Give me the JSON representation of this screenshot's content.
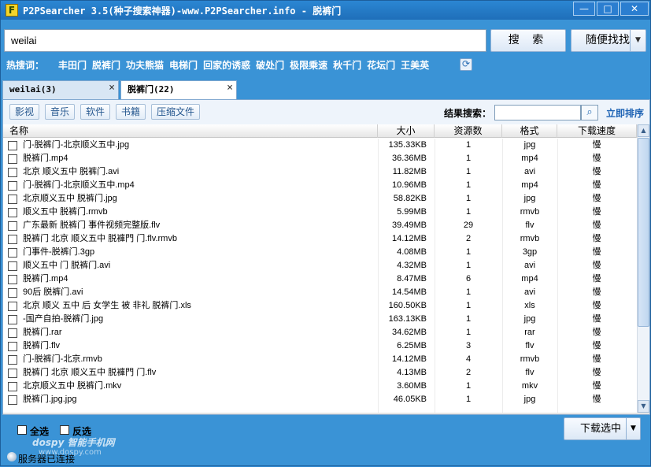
{
  "window": {
    "icon_letter": "F",
    "title": "P2PSearcher 3.5(种子搜索神器)-www.P2PSearcher.info - 脱裤门",
    "min_glyph": "—",
    "max_glyph": "□",
    "close_glyph": "✕"
  },
  "search": {
    "query": "weilai",
    "search_button": "搜 索",
    "random_button": "随便找找"
  },
  "hot": {
    "label": "热搜词：",
    "items": [
      "丰田门",
      "脱裤门",
      "功夫熊猫",
      "电梯门",
      "回家的诱惑",
      "破处门",
      "极限乘速",
      "秋千门",
      "花坛门",
      "王美英"
    ]
  },
  "tabs": [
    {
      "label": "weilai(3)"
    },
    {
      "label": "脱裤门(22)"
    }
  ],
  "filters": [
    "影视",
    "音乐",
    "软件",
    "书籍",
    "压缩文件"
  ],
  "result_search": {
    "label": "结果搜索：",
    "sort_link": "立即排序"
  },
  "table": {
    "headers": {
      "name": "名称",
      "size": "大小",
      "sources": "资源数",
      "format": "格式",
      "speed": "下载速度"
    },
    "rows": [
      {
        "name": "门-脱裤门-北京顺义五中.jpg",
        "size": "135.33KB",
        "sources": "1",
        "format": "jpg",
        "speed": "慢"
      },
      {
        "name": "脱裤门.mp4",
        "size": "36.36MB",
        "sources": "1",
        "format": "mp4",
        "speed": "慢"
      },
      {
        "name": "北京 顺义五中 脱裤门.avi",
        "size": "11.82MB",
        "sources": "1",
        "format": "avi",
        "speed": "慢"
      },
      {
        "name": "门-脱裤门-北京顺义五中.mp4",
        "size": "10.96MB",
        "sources": "1",
        "format": "mp4",
        "speed": "慢"
      },
      {
        "name": "北京顺义五中 脱裤门.jpg",
        "size": "58.82KB",
        "sources": "1",
        "format": "jpg",
        "speed": "慢"
      },
      {
        "name": "顺义五中 脱裤门.rmvb",
        "size": "5.99MB",
        "sources": "1",
        "format": "rmvb",
        "speed": "慢"
      },
      {
        "name": "广东最新 脱裤门 事件视频完整版.flv",
        "size": "39.49MB",
        "sources": "29",
        "format": "flv",
        "speed": "慢"
      },
      {
        "name": "脱裤门 北京 顺义五中 脱褲門 门.flv.rmvb",
        "size": "14.12MB",
        "sources": "2",
        "format": "rmvb",
        "speed": "慢"
      },
      {
        "name": "门事件-脱裤门.3gp",
        "size": "4.08MB",
        "sources": "1",
        "format": "3gp",
        "speed": "慢"
      },
      {
        "name": "顺义五中 门 脱裤门.avi",
        "size": "4.32MB",
        "sources": "1",
        "format": "avi",
        "speed": "慢"
      },
      {
        "name": "脱裤门.mp4",
        "size": "8.47MB",
        "sources": "6",
        "format": "mp4",
        "speed": "慢"
      },
      {
        "name": "90后 脱裤门.avi",
        "size": "14.54MB",
        "sources": "1",
        "format": "avi",
        "speed": "慢"
      },
      {
        "name": "北京 顺义 五中 后 女学生 被 非礼 脱裤门.xls",
        "size": "160.50KB",
        "sources": "1",
        "format": "xls",
        "speed": "慢"
      },
      {
        "name": "-国产自拍-脱裤门.jpg",
        "size": "163.13KB",
        "sources": "1",
        "format": "jpg",
        "speed": "慢"
      },
      {
        "name": "脱裤门.rar",
        "size": "34.62MB",
        "sources": "1",
        "format": "rar",
        "speed": "慢"
      },
      {
        "name": "脱裤门.flv",
        "size": "6.25MB",
        "sources": "3",
        "format": "flv",
        "speed": "慢"
      },
      {
        "name": "门-脱裤门-北京.rmvb",
        "size": "14.12MB",
        "sources": "4",
        "format": "rmvb",
        "speed": "慢"
      },
      {
        "name": "脱裤门 北京 顺义五中 脱褲門 门.flv",
        "size": "4.13MB",
        "sources": "2",
        "format": "flv",
        "speed": "慢"
      },
      {
        "name": "北京顺义五中 脱裤门.mkv",
        "size": "3.60MB",
        "sources": "1",
        "format": "mkv",
        "speed": "慢"
      },
      {
        "name": "脱裤门.jpg.jpg",
        "size": "46.05KB",
        "sources": "1",
        "format": "jpg",
        "speed": "慢"
      }
    ]
  },
  "bottom": {
    "select_all": "全选",
    "invert": "反选",
    "download_button": "下载选中",
    "status": "服务器已连接"
  },
  "watermark": {
    "line1": "dospy 智能手机网",
    "line2": "www.dospy.com"
  }
}
